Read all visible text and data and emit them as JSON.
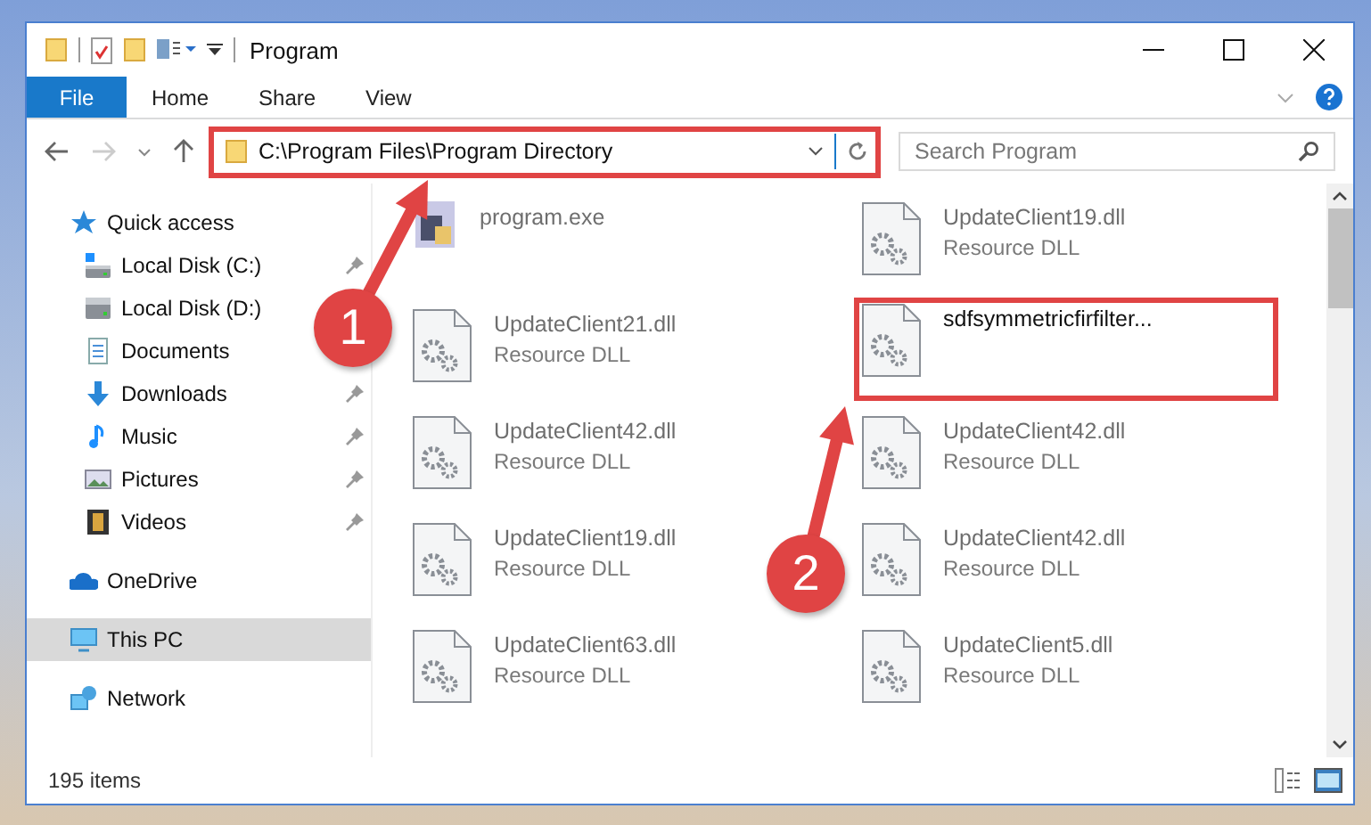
{
  "window": {
    "title": "Program"
  },
  "ribbon_tabs": [
    {
      "label": "File",
      "selected": true
    },
    {
      "label": "Home",
      "selected": false
    },
    {
      "label": "Share",
      "selected": false
    },
    {
      "label": "View",
      "selected": false
    }
  ],
  "address": {
    "path": "C:\\Program Files\\Program Directory",
    "highlighted": true
  },
  "search": {
    "placeholder": "Search Program"
  },
  "sidebar": {
    "items": [
      {
        "label": "Quick access",
        "kind": "star",
        "pinned": false,
        "selected": false,
        "children": [
          {
            "label": "Local Disk (C:)",
            "kind": "disk-c",
            "pinned": true,
            "selected": false
          },
          {
            "label": "Local Disk (D:)",
            "kind": "disk",
            "pinned": false,
            "selected": false
          },
          {
            "label": "Documents",
            "kind": "document",
            "pinned": false,
            "selected": false
          },
          {
            "label": "Downloads",
            "kind": "download",
            "pinned": true,
            "selected": false
          },
          {
            "label": "Music",
            "kind": "music",
            "pinned": true,
            "selected": false
          },
          {
            "label": "Pictures",
            "kind": "pictures",
            "pinned": true,
            "selected": false
          },
          {
            "label": "Videos",
            "kind": "video",
            "pinned": true,
            "selected": false
          }
        ]
      },
      {
        "label": "OneDrive",
        "kind": "cloud",
        "pinned": false,
        "selected": false
      },
      {
        "label": "This PC",
        "kind": "pc",
        "pinned": false,
        "selected": true
      },
      {
        "label": "Network",
        "kind": "network",
        "pinned": false,
        "selected": false
      }
    ]
  },
  "files": [
    {
      "name": "program.exe",
      "kind": "exe",
      "highlighted": false
    },
    {
      "name": "UpdateClient19.dll",
      "type": "Resource DLL",
      "kind": "dll",
      "highlighted": false
    },
    {
      "name": "UpdateClient21.dll",
      "type": "Resource DLL",
      "kind": "dll",
      "highlighted": false
    },
    {
      "name": "sdfsymmetricfirfilter...",
      "kind": "dll",
      "highlighted": true
    },
    {
      "name": "UpdateClient42.dll",
      "type": "Resource DLL",
      "kind": "dll",
      "highlighted": false
    },
    {
      "name": "UpdateClient42.dll",
      "type": "Resource DLL",
      "kind": "dll",
      "highlighted": false
    },
    {
      "name": "UpdateClient19.dll",
      "type": "Resource DLL",
      "kind": "dll",
      "highlighted": false
    },
    {
      "name": "UpdateClient42.dll",
      "type": "Resource DLL",
      "kind": "dll",
      "highlighted": false
    },
    {
      "name": "UpdateClient63.dll",
      "type": "Resource DLL",
      "kind": "dll",
      "highlighted": false
    },
    {
      "name": "UpdateClient5.dll",
      "type": "Resource DLL",
      "kind": "dll",
      "highlighted": false
    }
  ],
  "status_bar": {
    "count": "195 items"
  },
  "annotations": [
    {
      "label": "1"
    },
    {
      "label": "2"
    }
  ]
}
